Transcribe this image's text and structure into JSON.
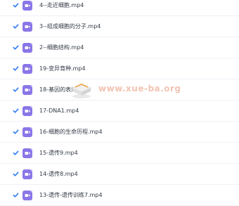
{
  "files": [
    {
      "name": "4--走近细胞.mp4",
      "checked": true
    },
    {
      "name": "3--组成细胞的分子.mp4",
      "checked": true
    },
    {
      "name": "2--细胞结构.mp4",
      "checked": true
    },
    {
      "name": "19-变异育种.mp4",
      "checked": true
    },
    {
      "name": "18-基因的表达.mp4",
      "checked": true
    },
    {
      "name": "17-DNA1.mp4",
      "checked": true
    },
    {
      "name": "16-细胞的生命历程.mp4",
      "checked": true
    },
    {
      "name": "15-遗传9.mp4",
      "checked": true
    },
    {
      "name": "14-遗传8.mp4",
      "checked": true
    },
    {
      "name": "13-遗传-遗传训练7.mp4",
      "checked": true
    }
  ],
  "watermark": {
    "text": "www.xue-ba.org"
  },
  "colors": {
    "checkbox_blue": "#2f7cf6",
    "video_icon_purple": "#8a76e8",
    "watermark_text": "#f2c4b2"
  },
  "icons": {
    "checkbox": "checkbox-checked-icon",
    "file": "video-file-icon"
  }
}
